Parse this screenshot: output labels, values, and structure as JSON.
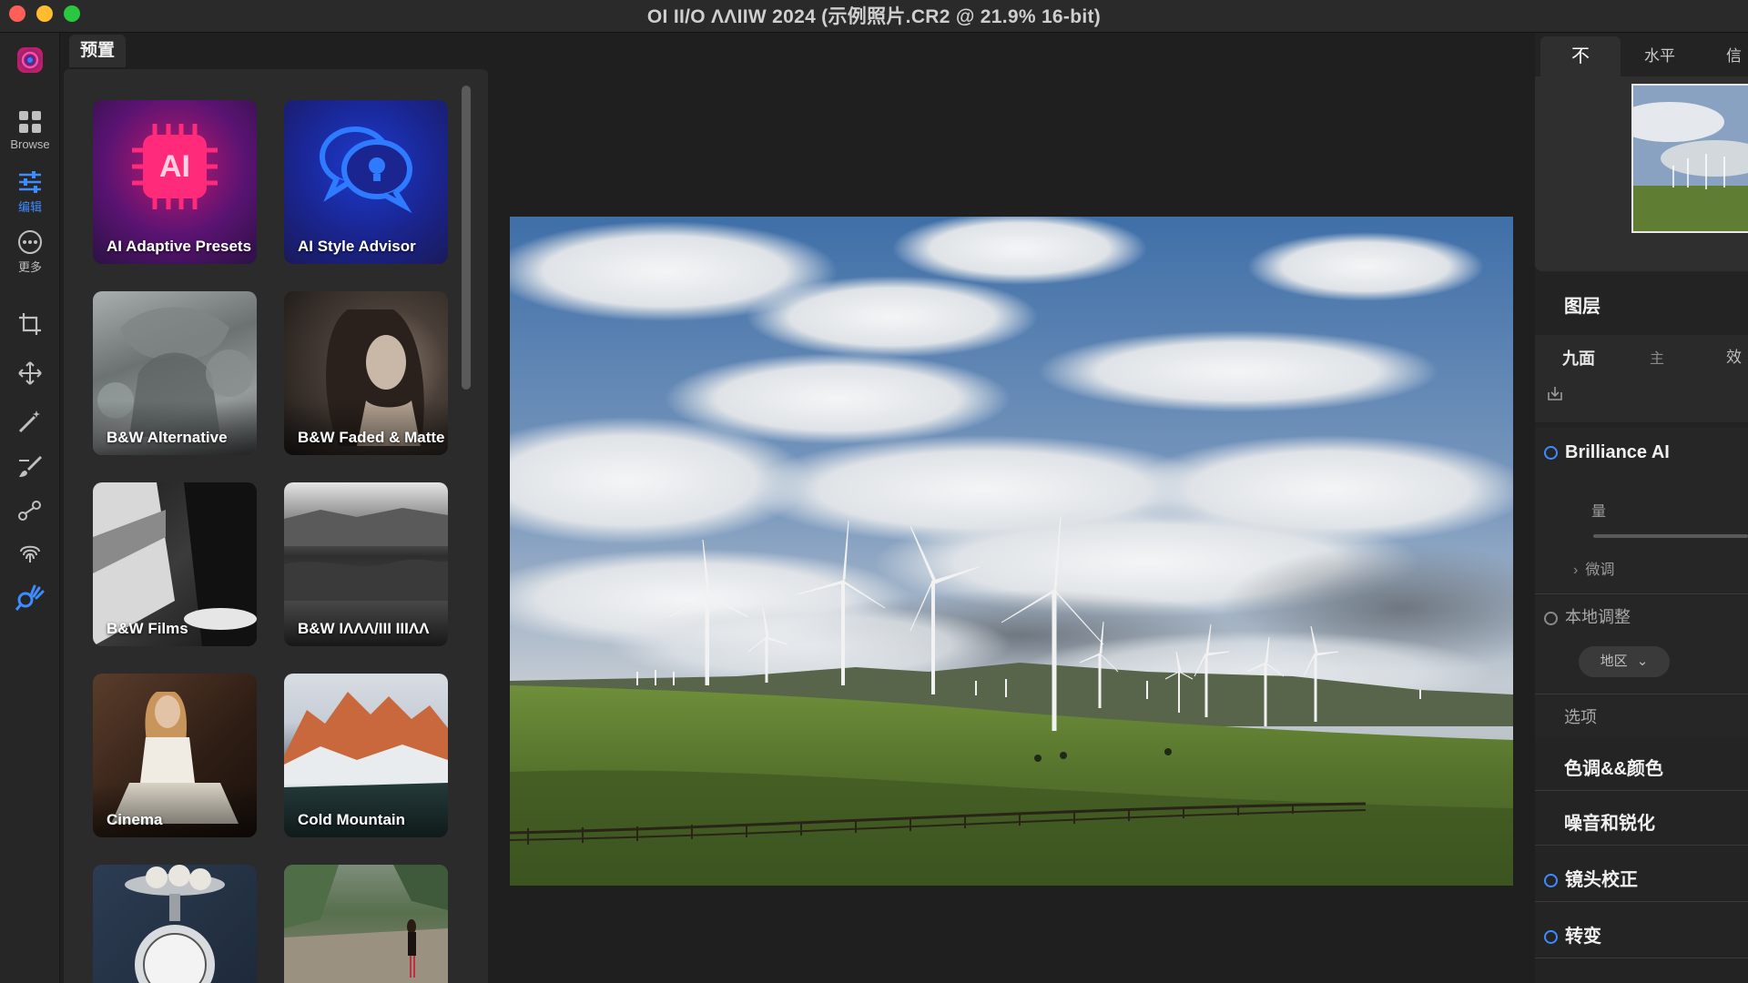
{
  "window": {
    "title": "OI II/O ΛΛIIW 2024 (示例照片.CR2 @ 21.9% 16-bit)"
  },
  "toolbar": {
    "browse_label": "Browse",
    "edit_label": "编辑",
    "more_label": "更多",
    "tools": [
      "crop-icon",
      "move-icon",
      "magic-wand-icon",
      "brush-icon",
      "nodes-icon",
      "fingerprint-icon",
      "search-hand-icon"
    ]
  },
  "presets": {
    "tab_label": "预置",
    "cards": [
      {
        "label": "AI Adaptive Presets"
      },
      {
        "label": "AI Style Advisor"
      },
      {
        "label": "B&W Alternative"
      },
      {
        "label": "B&W Faded & Matte"
      },
      {
        "label": "B&W Films"
      },
      {
        "label": "B&W ΙΛΛΛ/ΙΙΙ ΙΙΙΛΛ"
      },
      {
        "label": "Cinema"
      },
      {
        "label": "Cold Mountain"
      },
      {
        "label": ""
      },
      {
        "label": ""
      }
    ]
  },
  "right_panel": {
    "tabs": [
      "不",
      "水平",
      "信"
    ],
    "layers_title": "图层",
    "layer_tabs": [
      "九面",
      "主",
      "效"
    ],
    "brilliance_label": "Brilliance AI",
    "amount_label": "量",
    "fine_tune_label": "微调",
    "local_adjust_label": "本地调整",
    "region_button_label": "地区",
    "options_label": "选项",
    "tone_color_label": "色调&&颜色",
    "noise_sharpen_label": "噪音和锐化",
    "lens_correction_label": "镜头校正",
    "transform_label": "转变"
  },
  "colors": {
    "accent": "#3d8bff",
    "background": "#1f1f1f",
    "panel": "#2b2b2b"
  }
}
